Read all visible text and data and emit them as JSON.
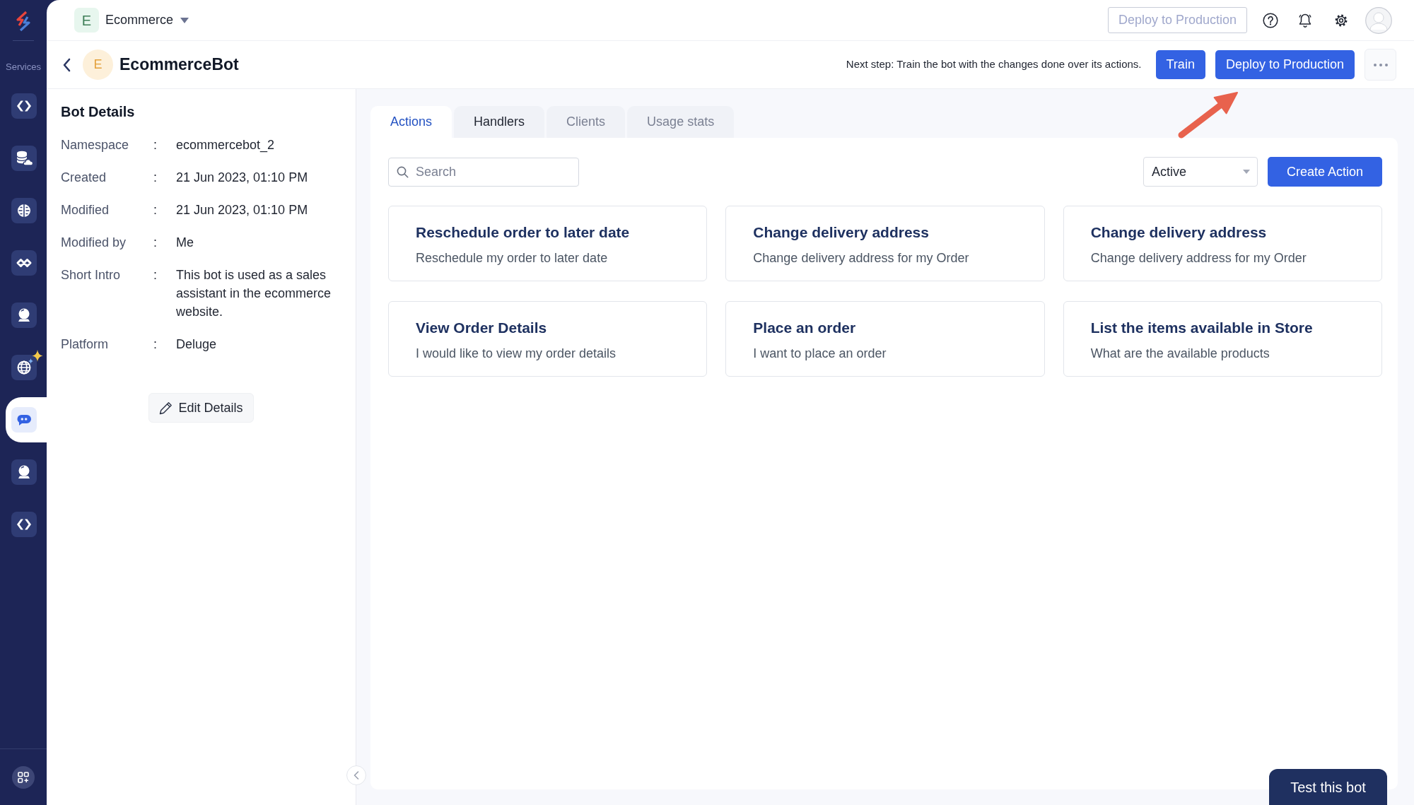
{
  "sidebar": {
    "label": "Services",
    "items": [
      {
        "selected": false
      },
      {
        "selected": false
      },
      {
        "selected": false
      },
      {
        "selected": false
      },
      {
        "selected": false
      },
      {
        "selected": false
      },
      {
        "selected": true
      },
      {
        "selected": false
      },
      {
        "selected": false
      }
    ]
  },
  "top_bar": {
    "workspace": {
      "initial": "E",
      "name": "Ecommerce"
    },
    "deploy_button": {
      "label": "Deploy to Production",
      "disabled": true
    }
  },
  "bot_header": {
    "initial": "E",
    "name": "EcommerceBot",
    "next_step": "Next step: Train the bot with the changes done over its actions.",
    "buttons": [
      {
        "label": "Train"
      },
      {
        "label": "Deploy to Production"
      }
    ]
  },
  "bot_details": {
    "title": "Bot Details",
    "fields": [
      {
        "label": "Namespace",
        "separator": ":",
        "value": "ecommercebot_2"
      },
      {
        "label": "Created",
        "separator": ":",
        "value": "21 Jun 2023, 01:10 PM"
      },
      {
        "label": "Modified",
        "separator": ":",
        "value": "21 Jun 2023, 01:10 PM"
      },
      {
        "label": "Modified by",
        "separator": ":",
        "value": "Me"
      },
      {
        "label": "Short Intro",
        "separator": ":",
        "value": "This bot is used as a sales assistant in the ecommerce website."
      },
      {
        "label": "Platform",
        "separator": ":",
        "value": "Deluge"
      }
    ],
    "edit_button": "Edit Details"
  },
  "tabs": [
    {
      "label": "Actions",
      "selected": true,
      "disabled": false
    },
    {
      "label": "Handlers",
      "selected": false,
      "disabled": false
    },
    {
      "label": "Clients",
      "selected": false,
      "disabled": true
    },
    {
      "label": "Usage stats",
      "selected": false,
      "disabled": true
    }
  ],
  "toolbar": {
    "search": {
      "placeholder": "Search"
    },
    "status_filter": {
      "value": "Active"
    },
    "create_button": "Create Action"
  },
  "actions": [
    {
      "title": "Reschedule order to later date",
      "description": "Reschedule my order to later date"
    },
    {
      "title": "Change delivery address",
      "description": "Change delivery address for my Order"
    },
    {
      "title": "Change delivery address",
      "description": "Change delivery address for my Order"
    },
    {
      "title": "View Order Details",
      "description": "I would like to view my order details"
    },
    {
      "title": "Place an order",
      "description": "I want to place an order"
    },
    {
      "title": "List the items available in Store",
      "description": "What are the available products"
    }
  ],
  "test_button": "Test this bot"
}
